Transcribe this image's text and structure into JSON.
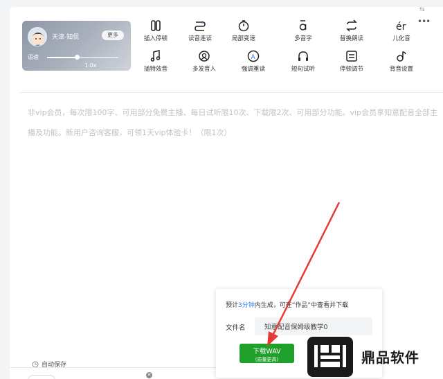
{
  "voice": {
    "name": "天津-知侃",
    "more_label": "更多",
    "speed_label": "语速",
    "speed_value": "1.0x",
    "speed_fraction": 0.42
  },
  "toolbar": {
    "row1": [
      {
        "label": "插入停顿",
        "icon": "pause-icon"
      },
      {
        "label": "读音连读",
        "icon": "link-read-icon"
      },
      {
        "label": "局部变速",
        "icon": "speed-icon"
      },
      {
        "label": "多音字",
        "icon": "polyphone-icon"
      },
      {
        "label": "替换朗读",
        "icon": "replace-icon"
      },
      {
        "label": "儿化音",
        "icon": "erhua-icon"
      }
    ],
    "row2": [
      {
        "label": "插特效音",
        "icon": "music-note-icon"
      },
      {
        "label": "多发音人",
        "icon": "multi-speaker-icon"
      },
      {
        "label": "强调重读",
        "icon": "emphasis-icon"
      },
      {
        "label": "短句试听",
        "icon": "headphone-icon"
      },
      {
        "label": "停顿调节",
        "icon": "pause-adjust-icon"
      },
      {
        "label": "背音设置",
        "icon": "bgm-icon"
      }
    ]
  },
  "editor": {
    "placeholder": "非vip会员，每次限100字、可用部分免费主播、每日试听限10次、下载限2次、可用部分功能。vip会员享知意配音全部主播及功能。新用户咨询客服，可领1天vip体验卡！（限1次）"
  },
  "footer": {
    "autosave_label": "自动保存"
  },
  "popup": {
    "info_prefix": "预计",
    "info_highlight": "3分钟",
    "info_suffix": "内生成，可在“作品”中查看并下载",
    "filename_label": "文件名",
    "filename_value": "知意配音保姆级教学0",
    "download_label": "下载WAV",
    "download_sub": "(质量更高)"
  },
  "watermark": {
    "text": "鼎品软件"
  },
  "colors": {
    "accent_blue": "#2b7de9",
    "download_green": "#1fa02b",
    "arrow_red": "#e53935"
  }
}
